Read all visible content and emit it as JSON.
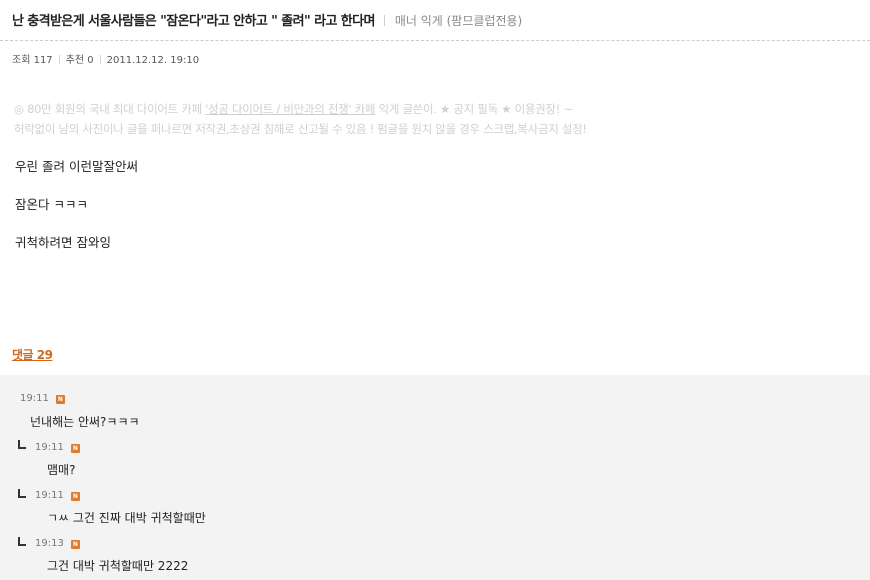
{
  "post": {
    "title": "난 충격받은게 서울사람들은 \"잠온다\"라고 안하고 \" 졸려\" 라고 한다며",
    "board": "매너 익게 (팜므클럽전용)",
    "views_label": "조회 117",
    "recommend_label": "추천 0",
    "date": "2011.12.12. 19:10"
  },
  "notice": {
    "line1_prefix": "◎ 80만 회원의 국내 최대 다이어트 카페 ",
    "line1_link": "'성공 다이어트 / 비만과의 전쟁' 카페",
    "line1_suffix": " 익게 글쓴이.  ★ 공지 필독 ★ 이용권장! ~",
    "line2": "허락없이 남의 사진이나 글을 퍼나르면 저작권,초상권 침해로 신고될 수 있음 !  펌글을 원치 않을 경우 스크랩,복사금지 설정!"
  },
  "body": {
    "lines": [
      "우린 졸려 이런말잘안써",
      "잠온다 ㅋㅋㅋ",
      "귀척하려면 잠와잉"
    ]
  },
  "comments_section": {
    "link_label": "댓글 29",
    "badge_letter": "N",
    "items": [
      {
        "time": "19:11",
        "text": "넌내해는 안써?ㅋㅋㅋ"
      },
      {
        "time": "19:11",
        "text": "맴매?"
      },
      {
        "time": "19:11",
        "text": "ㄱㅆ 그건 진짜 대박 귀척할때만"
      },
      {
        "time": "19:13",
        "text": "그건 대박 귀척할때만 2222"
      }
    ]
  },
  "colors": {
    "comment_link": "#d2691e",
    "badge": "#e07b2c",
    "comment_bg": "#f3f3f3"
  }
}
